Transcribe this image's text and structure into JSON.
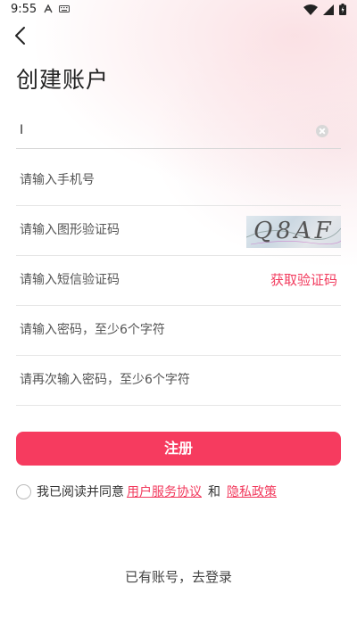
{
  "status_bar": {
    "time": "9:55",
    "icons": [
      "a-icon",
      "keyboard-icon",
      "wifi-icon",
      "signal-icon",
      "battery-icon"
    ]
  },
  "header": {
    "back_icon": "chevron-left-icon",
    "title": "创建账户"
  },
  "form": {
    "username_value": "I",
    "phone_placeholder": "请输入手机号",
    "captcha_placeholder": "请输入图形验证码",
    "captcha_image_text": "Q8AF",
    "sms_placeholder": "请输入短信验证码",
    "sms_button": "获取验证码",
    "password_placeholder": "请输入密码，至少6个字符",
    "confirm_password_placeholder": "请再次输入密码，至少6个字符"
  },
  "register_button": "注册",
  "agreement": {
    "prefix": "我已阅读并同意",
    "terms_link": "用户服务协议",
    "and": "和",
    "privacy_link": "隐私政策"
  },
  "login_link": "已有账号，去登录",
  "colors": {
    "accent": "#f63b5f",
    "link": "#f23a5d"
  }
}
